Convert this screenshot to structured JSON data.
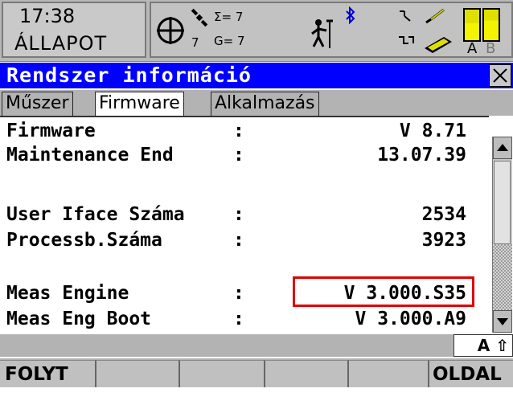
{
  "status": {
    "time": "17:38",
    "mode": "ÁLLAPOT",
    "sigma_label": "Σ= 7",
    "gps_label": "G= 7",
    "sat_count": "7",
    "battery_a": "A",
    "battery_b": "B"
  },
  "title": "Rendszer információ",
  "tabs": [
    {
      "label": "Műszer",
      "active": false
    },
    {
      "label": "Firmware",
      "active": true
    },
    {
      "label": "Alkalmazás",
      "active": false
    }
  ],
  "rows": [
    {
      "label": "Firmware",
      "colon": ":",
      "value": "V 8.71"
    },
    {
      "label": "Maintenance End",
      "colon": ":",
      "value": "13.07.39"
    },
    {
      "label": "User Iface Száma",
      "colon": ":",
      "value": "2534"
    },
    {
      "label": "Processb.Száma",
      "colon": ":",
      "value": "3923"
    },
    {
      "label": "Meas Engine",
      "colon": ":",
      "value": "V 3.000.S35"
    },
    {
      "label": "Meas Eng Boot",
      "colon": ":",
      "value": "V 3.000.A9"
    }
  ],
  "input_mode": "A ⇧",
  "softkeys": [
    "FOLYT",
    "",
    "",
    "",
    "",
    "OLDAL"
  ],
  "colors": {
    "title_bg": "#0000ff",
    "highlight": "#e00000",
    "chrome": "#b3b3b3"
  }
}
